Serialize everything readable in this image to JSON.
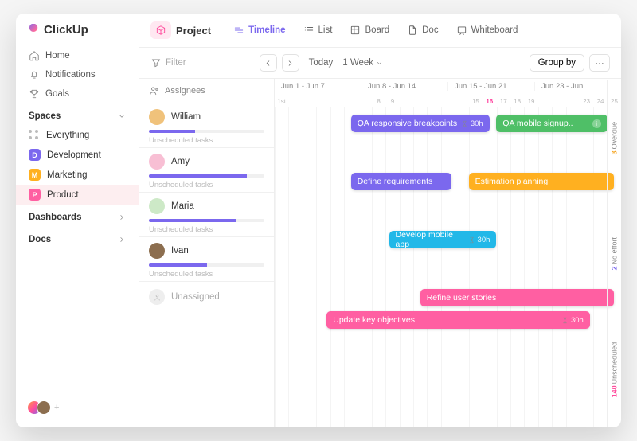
{
  "brand": "ClickUp",
  "nav": {
    "home": "Home",
    "notifications": "Notifications",
    "goals": "Goals"
  },
  "sections": {
    "spaces": "Spaces",
    "dashboards": "Dashboards",
    "docs": "Docs"
  },
  "spaces": {
    "everything": "Everything",
    "development": {
      "label": "Development",
      "initial": "D",
      "color": "#7b68ee"
    },
    "marketing": {
      "label": "Marketing",
      "initial": "M",
      "color": "#ffb020"
    },
    "product": {
      "label": "Product",
      "initial": "P",
      "color": "#ff5fa2"
    }
  },
  "project": {
    "label": "Project"
  },
  "views": {
    "timeline": "Timeline",
    "list": "List",
    "board": "Board",
    "doc": "Doc",
    "whiteboard": "Whiteboard"
  },
  "filterbar": {
    "filter": "Filter",
    "today": "Today",
    "range": "1 Week",
    "groupby": "Group by"
  },
  "timeline_header": {
    "group_label": "Assignees",
    "weeks": [
      "Jun 1 - Jun 7",
      "Jun 8 - Jun 14",
      "Jun 15 - Jun 21",
      "Jun 23 - Jun"
    ],
    "days": [
      "1st",
      "",
      "",
      "",
      "",
      "",
      "",
      "8",
      "9",
      "",
      "",
      "",
      "",
      "",
      "15",
      "16",
      "17",
      "18",
      "19",
      "",
      "",
      "",
      "23",
      "24",
      "25"
    ],
    "today_index": 15
  },
  "assignees": [
    {
      "name": "William",
      "progress": 40,
      "unscheduled": "Unscheduled tasks",
      "avatar": "#f0c27b"
    },
    {
      "name": "Amy",
      "progress": 85,
      "unscheduled": "Unscheduled tasks",
      "avatar": "#f8bfd4"
    },
    {
      "name": "Maria",
      "progress": 75,
      "unscheduled": "Unscheduled tasks",
      "avatar": "#cde9c7"
    },
    {
      "name": "Ivan",
      "progress": 50,
      "unscheduled": "Unscheduled tasks",
      "avatar": "#8c6e4f"
    },
    {
      "name": "Unassigned"
    }
  ],
  "tasks": {
    "qa_resp": {
      "label": "QA responsive breakpoints",
      "meta": "30h"
    },
    "qa_mob": {
      "label": "QA mobile signup.."
    },
    "define": {
      "label": "Define requirements"
    },
    "estim": {
      "label": "Estimation planning"
    },
    "develop": {
      "label": "Develop mobile app",
      "meta": "30h"
    },
    "refine": {
      "label": "Refine user stories"
    },
    "update": {
      "label": "Update key objectives",
      "meta": "30h"
    }
  },
  "edge": {
    "overdue": {
      "n": "3",
      "label": "Overdue"
    },
    "noeffort": {
      "n": "2",
      "label": "No effort"
    },
    "unsched": {
      "n": "140",
      "label": "Unscheduled"
    }
  },
  "colors": {
    "purple": "#7b68ee",
    "green": "#4fbf67",
    "orange": "#ffb020",
    "cyan": "#22b8e8",
    "pink": "#ff5fa2"
  }
}
